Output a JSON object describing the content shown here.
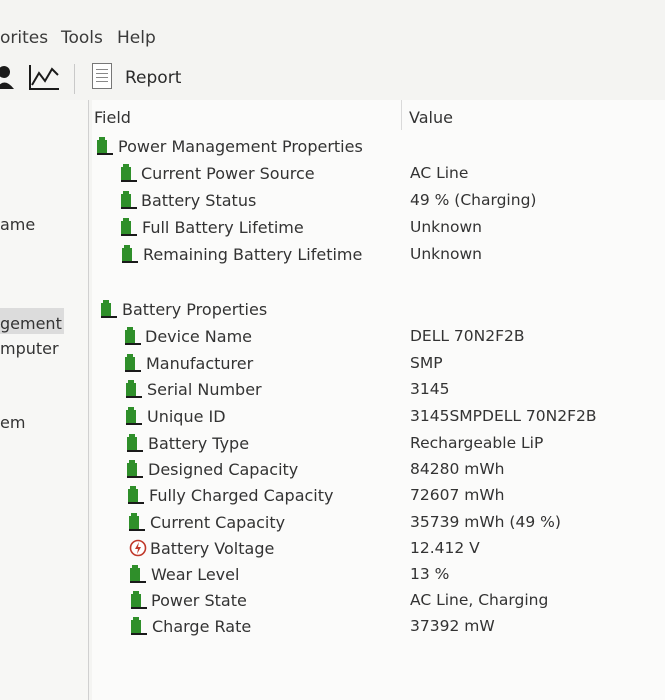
{
  "menubar": {
    "favorites": "orites",
    "tools": "Tools",
    "help": "Help"
  },
  "toolbar": {
    "report_label": "Report"
  },
  "left_pane": {
    "items": [
      "ame",
      "gement",
      "mputer",
      "em"
    ]
  },
  "grid": {
    "col_field": "Field",
    "col_value": "Value",
    "sections": [
      {
        "title": "Power Management Properties",
        "rows": [
          {
            "field": "Current Power Source",
            "value": "AC Line",
            "icon": "battery-icon"
          },
          {
            "field": "Battery Status",
            "value": "49 % (Charging)",
            "icon": "battery-icon"
          },
          {
            "field": "Full Battery Lifetime",
            "value": "Unknown",
            "icon": "battery-icon"
          },
          {
            "field": "Remaining Battery Lifetime",
            "value": "Unknown",
            "icon": "battery-icon"
          }
        ]
      },
      {
        "title": "Battery Properties",
        "rows": [
          {
            "field": "Device Name",
            "value": "DELL 70N2F2B",
            "icon": "battery-icon"
          },
          {
            "field": "Manufacturer",
            "value": "SMP",
            "icon": "battery-icon"
          },
          {
            "field": "Serial Number",
            "value": "3145",
            "icon": "battery-icon"
          },
          {
            "field": "Unique ID",
            "value": "3145SMPDELL 70N2F2B",
            "icon": "battery-icon"
          },
          {
            "field": "Battery Type",
            "value": "Rechargeable LiP",
            "icon": "battery-icon"
          },
          {
            "field": "Designed Capacity",
            "value": "84280 mWh",
            "icon": "battery-icon"
          },
          {
            "field": "Fully Charged Capacity",
            "value": "72607 mWh",
            "icon": "battery-icon"
          },
          {
            "field": "Current Capacity",
            "value": "35739 mWh  (49 %)",
            "icon": "battery-icon"
          },
          {
            "field": "Battery Voltage",
            "value": "12.412 V",
            "icon": "voltage-icon"
          },
          {
            "field": "Wear Level",
            "value": "13 %",
            "icon": "battery-icon"
          },
          {
            "field": "Power State",
            "value": "AC Line, Charging",
            "icon": "battery-icon"
          },
          {
            "field": "Charge Rate",
            "value": "37392 mW",
            "icon": "battery-icon"
          }
        ]
      }
    ]
  }
}
